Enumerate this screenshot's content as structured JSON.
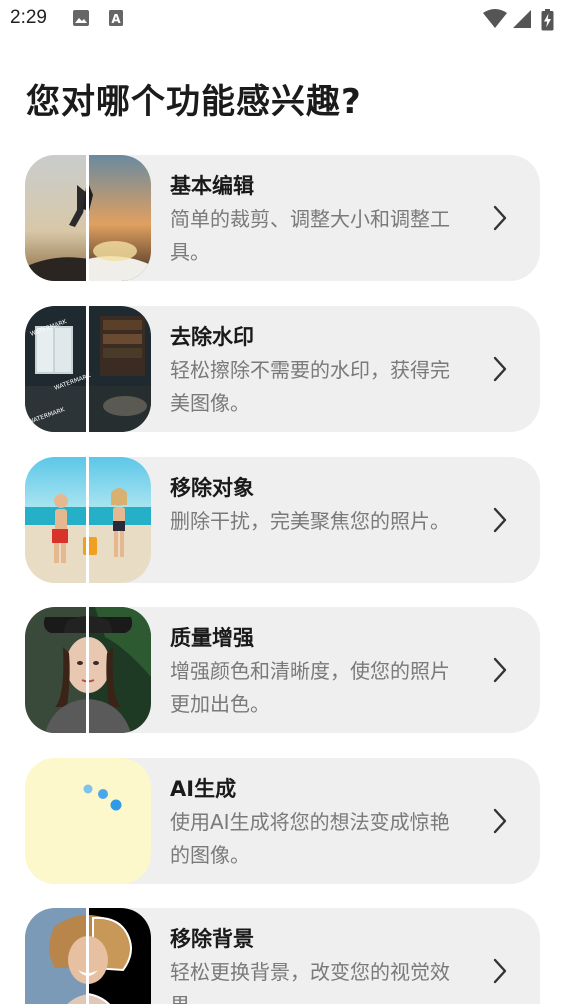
{
  "status_bar": {
    "time": "2:29",
    "left_icons": [
      "image-icon",
      "a-notification-icon"
    ],
    "right_icons": [
      "wifi-icon",
      "signal-icon",
      "battery-charging-icon"
    ]
  },
  "page": {
    "title": "您对哪个功能感兴趣?"
  },
  "features": [
    {
      "title": "基本编辑",
      "description": "简单的裁剪、调整大小和调整工具。",
      "icon": "chevron-right-icon"
    },
    {
      "title": "去除水印",
      "description": "轻松擦除不需要的水印，获得完美图像。",
      "icon": "chevron-right-icon"
    },
    {
      "title": "移除对象",
      "description": "删除干扰，完美聚焦您的照片。",
      "icon": "chevron-right-icon"
    },
    {
      "title": "质量增强",
      "description": "增强颜色和清晰度，使您的照片更加出色。",
      "icon": "chevron-right-icon"
    },
    {
      "title": "AI生成",
      "description": "使用AI生成将您的想法变成惊艳的图像。",
      "icon": "chevron-right-icon"
    },
    {
      "title": "移除背景",
      "description": "轻松更换背景，改变您的视觉效果。",
      "icon": "chevron-right-icon"
    }
  ],
  "colors": {
    "card_background": "#efefef",
    "title_text": "#1b1b1b",
    "description_text": "#7a7a7a",
    "ai_thumbnail_background": "#fdf7cc",
    "ai_dot_color": "#2f9be6"
  }
}
